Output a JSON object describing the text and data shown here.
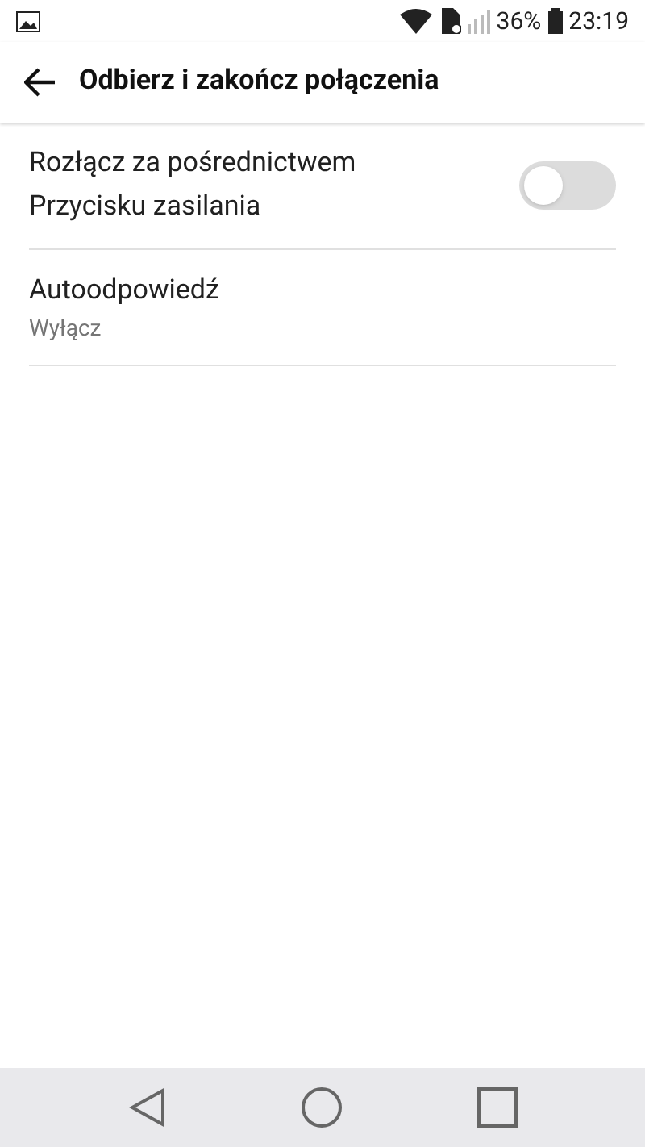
{
  "status_bar": {
    "battery": "36%",
    "time": "23:19"
  },
  "header": {
    "title": "Odbierz i zakończ połączenia"
  },
  "settings": [
    {
      "kind": "toggle",
      "title": "Rozłącz za pośrednictwem Przycisku zasilania",
      "on": false
    },
    {
      "kind": "subtitle",
      "title": "Autoodpowiedź",
      "subtitle": "Wyłącz"
    }
  ]
}
